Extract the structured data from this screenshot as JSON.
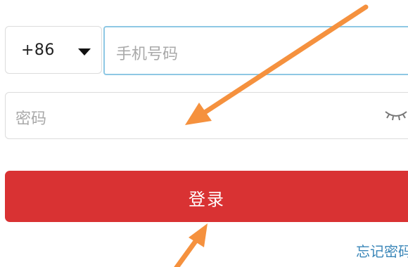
{
  "phone": {
    "country_code": "+86",
    "placeholder": "手机号码"
  },
  "password": {
    "placeholder": "密码",
    "visibility_icon": "eye-closed-icon"
  },
  "login": {
    "label": "登录",
    "color": "#d93233"
  },
  "forgot_password": {
    "label": "忘记密码"
  },
  "annotations": {
    "arrow_color": "#f5913e"
  }
}
